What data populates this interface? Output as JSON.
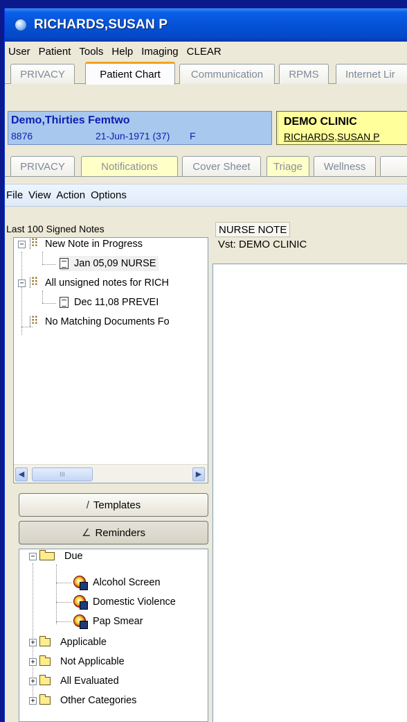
{
  "window": {
    "title": "RICHARDS,SUSAN P"
  },
  "menu": [
    "User",
    "Patient",
    "Tools",
    "Help",
    "Imaging",
    "CLEAR"
  ],
  "top_tabs": [
    {
      "label": "PRIVACY",
      "active": false
    },
    {
      "label": "Patient Chart",
      "active": true
    },
    {
      "label": "Communication",
      "active": false
    },
    {
      "label": "RPMS",
      "active": false
    },
    {
      "label": "Internet Lir",
      "active": false
    }
  ],
  "patient": {
    "name": "Demo,Thirties Femtwo",
    "id": "8876",
    "dob": "21-Jun-1971 (37)",
    "sex": "F"
  },
  "clinic": {
    "name": "DEMO CLINIC",
    "provider": "RICHARDS,SUSAN P"
  },
  "chart_tabs": [
    {
      "label": "PRIVACY"
    },
    {
      "label": "Notifications"
    },
    {
      "label": "Cover Sheet"
    },
    {
      "label": "Triage"
    },
    {
      "label": "Wellness"
    }
  ],
  "action_menu": [
    "File",
    "View",
    "Action",
    "Options"
  ],
  "notes": {
    "header": "Last 100 Signed Notes",
    "groups": [
      {
        "label": "New Note in Progress",
        "children": [
          "Jan 05,09  NURSE"
        ]
      },
      {
        "label": "All unsigned notes for RICH",
        "children": [
          "Dec 11,08  PREVEI"
        ]
      },
      {
        "label": "No Matching Documents Fo",
        "children": []
      }
    ],
    "scroll_grip": "III"
  },
  "buttons": {
    "templates": "Templates",
    "reminders": "Reminders"
  },
  "reminders": {
    "due_label": "Due",
    "due_items": [
      "Alcohol Screen",
      "Domestic Violence",
      "Pap Smear"
    ],
    "other_folders": [
      "Applicable",
      "Not Applicable",
      "All Evaluated",
      "Other Categories"
    ]
  },
  "note_view": {
    "title": "NURSE NOTE",
    "visit": "Vst:  DEMO CLINIC"
  }
}
